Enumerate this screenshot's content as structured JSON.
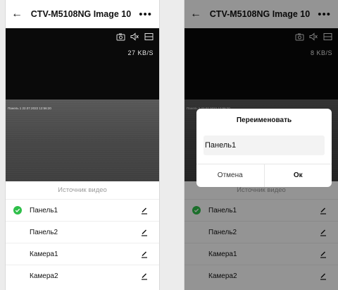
{
  "screen_left": {
    "header": {
      "back_icon": "arrow-left-icon",
      "title": "CTV-M5108NG Image 10",
      "more_icon": "more-dots-icon"
    },
    "video": {
      "icons": [
        "camera-icon",
        "mute-icon",
        "fullscreen-icon"
      ],
      "speed": "27 KB/S",
      "overlay_text": "Панель 1 22.07.2022 12:56:20"
    },
    "sheet": {
      "title": "Источник видео",
      "items": [
        {
          "label": "Панель1",
          "selected": true
        },
        {
          "label": "Панель2",
          "selected": false
        },
        {
          "label": "Камера1",
          "selected": false
        },
        {
          "label": "Камера2",
          "selected": false
        }
      ]
    }
  },
  "screen_right": {
    "header": {
      "back_icon": "arrow-left-icon",
      "title": "CTV-M5108NG Image 10",
      "more_icon": "more-dots-icon"
    },
    "video": {
      "icons": [
        "camera-icon",
        "mute-icon",
        "fullscreen-icon"
      ],
      "speed": "8 KB/S",
      "overlay_text": "Панель 1 22.07.2022 12:56:20"
    },
    "sheet": {
      "title": "Источник видео",
      "items": [
        {
          "label": "Панель1",
          "selected": true
        },
        {
          "label": "Панель2",
          "selected": false
        },
        {
          "label": "Камера1",
          "selected": false
        },
        {
          "label": "Камера2",
          "selected": false
        }
      ]
    },
    "dialog": {
      "title": "Переименовать",
      "input_value": "Панель1",
      "cancel_label": "Отмена",
      "ok_label": "Ок"
    }
  },
  "colors": {
    "accent_check": "#2fbf4a",
    "video_background": "#0a0a0a",
    "dim_overlay": "rgba(0,0,0,0.42)"
  }
}
